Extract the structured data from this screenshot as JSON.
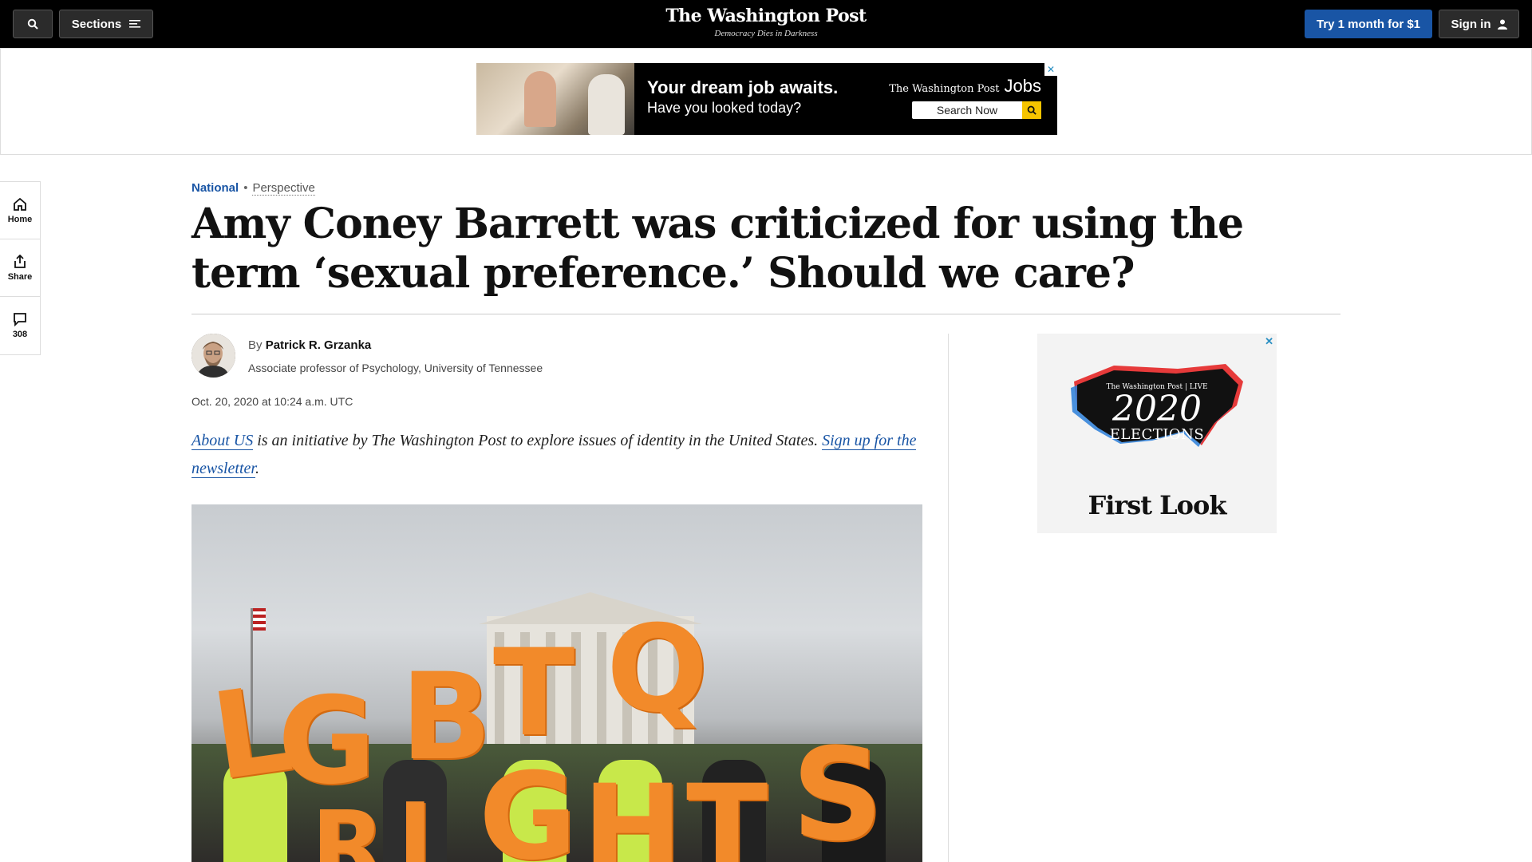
{
  "header": {
    "sections_label": "Sections",
    "logo": "The Washington Post",
    "tagline": "Democracy Dies in Darkness",
    "try_label": "Try 1 month for $1",
    "signin_label": "Sign in"
  },
  "top_ad": {
    "headline": "Your dream job awaits.",
    "subline": "Have you looked today?",
    "brand": "The Washington Post",
    "brand_suffix": "Jobs",
    "search_label": "Search Now",
    "close": "✕"
  },
  "left_rail": {
    "home_label": "Home",
    "share_label": "Share",
    "comments_count": "308"
  },
  "article": {
    "section": "National",
    "separator": "•",
    "label": "Perspective",
    "headline": "Amy Coney Barrett was criticized for using the term ‘sexual preference.’ Should we care?",
    "by_prefix": "By",
    "author": "Patrick R. Grzanka",
    "author_desc": "Associate professor of Psychology, University of Tennessee",
    "date": "Oct. 20, 2020 at 10:24 a.m. UTC",
    "intro_link1": "About US",
    "intro_text": " is an initiative by The Washington Post to explore issues of identity in the United States. ",
    "intro_link2": "Sign up for the newsletter",
    "intro_end": "."
  },
  "hero_image": {
    "letters": [
      "L",
      "G",
      "B",
      "T",
      "Q",
      "R",
      "I",
      "G",
      "H",
      "T",
      "S"
    ]
  },
  "right_ad": {
    "close": "✕",
    "live": "The Washington Post | LIVE",
    "year": "2020",
    "elections": "ELECTIONS",
    "first_look": "First Look"
  },
  "colors": {
    "accent_blue": "#1955a5",
    "topbar": "#000000",
    "sign_orange": "#f28a2a"
  }
}
